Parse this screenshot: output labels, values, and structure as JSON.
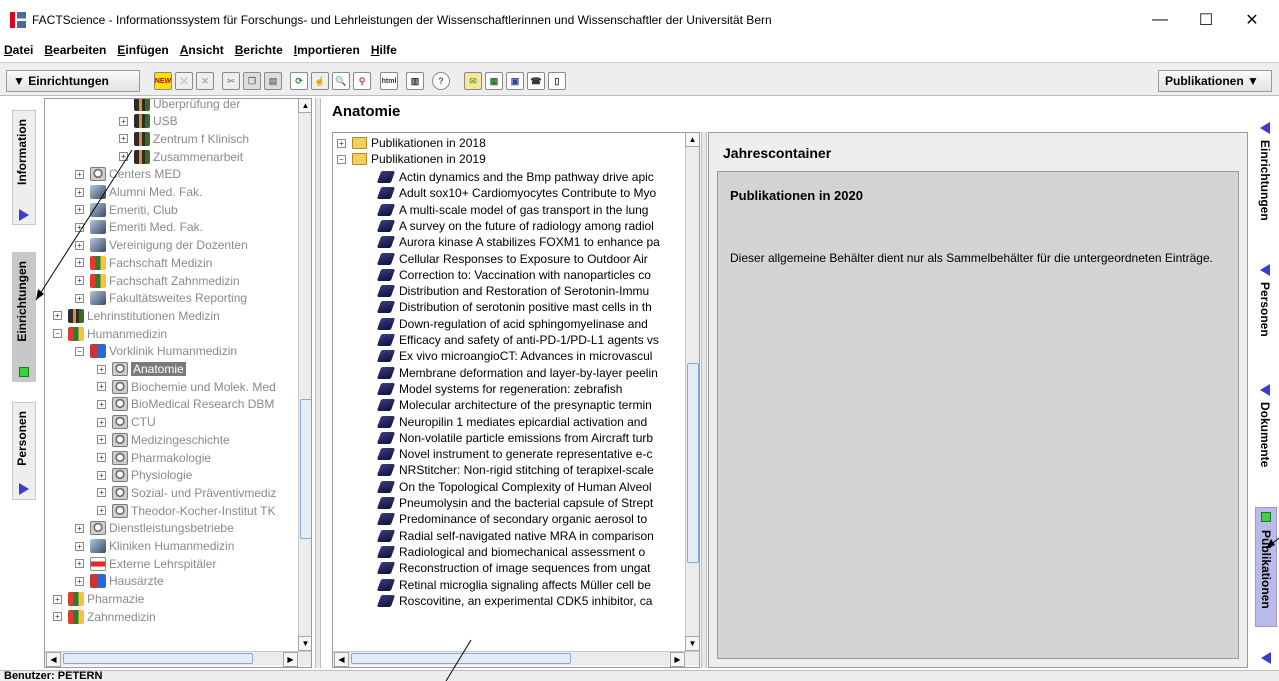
{
  "window": {
    "title": "FACTScience - Informationssystem für Forschungs- und Lehrleistungen der Wissenschaftlerinnen und Wissenschaftler der Universität Bern",
    "controls": [
      "—",
      "☐",
      "✕"
    ]
  },
  "menu": [
    "Datei",
    "Bearbeiten",
    "Einfügen",
    "Ansicht",
    "Berichte",
    "Importieren",
    "Hilfe"
  ],
  "toolbar": {
    "left_combo": "▼ Einrichtungen",
    "right_combo": "Publikationen ▼",
    "icons": [
      "new-icon",
      "strike-icon",
      "delete-icon",
      "cut-icon",
      "copy-icon",
      "paste-icon",
      "refresh-icon",
      "hand-icon",
      "search-icon",
      "find-icon",
      "html-icon",
      "layout-icon",
      "help-icon",
      "mail-icon",
      "chart-icon",
      "report-icon",
      "phone-icon",
      "book-icon"
    ],
    "new_label": "NEW",
    "html_label": "html"
  },
  "left_tabs": [
    "Information",
    "Einrichtungen",
    "Personen"
  ],
  "right_tabs": [
    "Einrichtungen",
    "Personen",
    "Dokumente",
    "Publikationen"
  ],
  "tree": [
    {
      "label": "Überprüfung der",
      "indent": 3,
      "icon": "people",
      "exp": ""
    },
    {
      "label": "USB",
      "indent": 3,
      "icon": "people",
      "exp": "+"
    },
    {
      "label": "Zentrum f Klinisch",
      "indent": 3,
      "icon": "people",
      "exp": "+"
    },
    {
      "label": "Zusammenarbeit",
      "indent": 3,
      "icon": "people",
      "exp": "+"
    },
    {
      "label": "Centers MED",
      "indent": 1,
      "icon": "dept",
      "exp": "+"
    },
    {
      "label": "Alumni Med. Fak.",
      "indent": 1,
      "icon": "photo",
      "exp": "+"
    },
    {
      "label": "Emeriti, Club",
      "indent": 1,
      "icon": "photo",
      "exp": "+"
    },
    {
      "label": "Emeriti Med. Fak.",
      "indent": 1,
      "icon": "photo",
      "exp": "+"
    },
    {
      "label": "Vereinigung der Dozenten",
      "indent": 1,
      "icon": "photo",
      "exp": "+"
    },
    {
      "label": "Fachschaft Medizin",
      "indent": 1,
      "icon": "group",
      "exp": "+"
    },
    {
      "label": "Fachschaft Zahnmedizin",
      "indent": 1,
      "icon": "group",
      "exp": "+"
    },
    {
      "label": "Fakultätsweites Reporting",
      "indent": 1,
      "icon": "photo",
      "exp": "+"
    },
    {
      "label": "Lehrinstitutionen Medizin",
      "indent": 0,
      "icon": "people",
      "exp": "+"
    },
    {
      "label": "Humanmedizin",
      "indent": 0,
      "icon": "group",
      "exp": "−"
    },
    {
      "label": "Vorklinik Humanmedizin",
      "indent": 1,
      "icon": "net",
      "exp": "−"
    },
    {
      "label": "Anatomie",
      "indent": 2,
      "icon": "dept",
      "exp": "+",
      "selected": true
    },
    {
      "label": "Biochemie und Molek. Med",
      "indent": 2,
      "icon": "dept",
      "exp": "+"
    },
    {
      "label": "BioMedical Research DBM",
      "indent": 2,
      "icon": "dept",
      "exp": "+"
    },
    {
      "label": "CTU",
      "indent": 2,
      "icon": "dept",
      "exp": "+"
    },
    {
      "label": "Medizingeschichte",
      "indent": 2,
      "icon": "dept",
      "exp": "+"
    },
    {
      "label": "Pharmakologie",
      "indent": 2,
      "icon": "dept",
      "exp": "+"
    },
    {
      "label": "Physiologie",
      "indent": 2,
      "icon": "dept",
      "exp": "+"
    },
    {
      "label": "Sozial- und Präventivmediz",
      "indent": 2,
      "icon": "dept",
      "exp": "+"
    },
    {
      "label": "Theodor-Kocher-Institut TK",
      "indent": 2,
      "icon": "dept",
      "exp": "+"
    },
    {
      "label": "Dienstleistungsbetriebe",
      "indent": 1,
      "icon": "dept",
      "exp": "+"
    },
    {
      "label": "Kliniken Humanmedizin",
      "indent": 1,
      "icon": "photo",
      "exp": "+"
    },
    {
      "label": "Externe Lehrspitäler",
      "indent": 1,
      "icon": "hospital",
      "exp": "+"
    },
    {
      "label": "Hausärzte",
      "indent": 1,
      "icon": "net",
      "exp": "+"
    },
    {
      "label": "Pharmazie",
      "indent": 0,
      "icon": "group",
      "exp": "+"
    },
    {
      "label": "Zahnmedizin",
      "indent": 0,
      "icon": "group",
      "exp": "+"
    }
  ],
  "main": {
    "title": "Anatomie",
    "folders": [
      "Publikationen in 2018",
      "Publikationen in 2019"
    ],
    "publications": [
      "Actin dynamics and the Bmp pathway drive apic",
      "Adult sox10+ Cardiomyocytes Contribute to Myo",
      "A multi-scale model of gas transport in the lung",
      "A survey on the future of radiology among radiol",
      "Aurora kinase A stabilizes FOXM1 to enhance pa",
      "Cellular Responses to Exposure to Outdoor Air",
      "Correction to: Vaccination with nanoparticles co",
      "Distribution and Restoration of Serotonin-Immu",
      "Distribution of serotonin positive mast cells in th",
      "Down-regulation of acid sphingomyelinase and",
      "Efficacy and safety of anti-PD-1/PD-L1 agents vs",
      "Ex vivo microangioCT: Advances in microvascul",
      "Membrane deformation and layer-by-layer peelin",
      "Model systems for regeneration: zebrafish",
      "Molecular architecture of the presynaptic termin",
      "Neuropilin 1 mediates epicardial activation and",
      "Non-volatile particle emissions from Aircraft turb",
      "Novel instrument to generate representative e-c",
      "NRStitcher: Non-rigid stitching of terapixel-scale",
      "On the Topological Complexity of Human Alveol",
      "Pneumolysin and the bacterial capsule of Strept",
      "Predominance of secondary organic aerosol to",
      "Radial self-navigated native MRA in comparison",
      "Radiological and biomechanical assessment o",
      "Reconstruction of image sequences from ungat",
      "Retinal microglia signaling affects Müller cell be",
      "Roscovitine, an experimental CDK5 inhibitor, ca"
    ]
  },
  "detail": {
    "header": "Jahrescontainer",
    "subtitle": "Publikationen in 2020",
    "description": "Dieser allgemeine Behälter dient nur als Sammelbehälter für die untergeordneten Einträge."
  },
  "status": {
    "text": "Benutzer: PETERN"
  },
  "colors": {
    "selection": "#7a7a7a",
    "tab_arrow": "#3b3bcf",
    "active_tab": "#b9b9ea",
    "green_indicator": "#3dd13d"
  }
}
